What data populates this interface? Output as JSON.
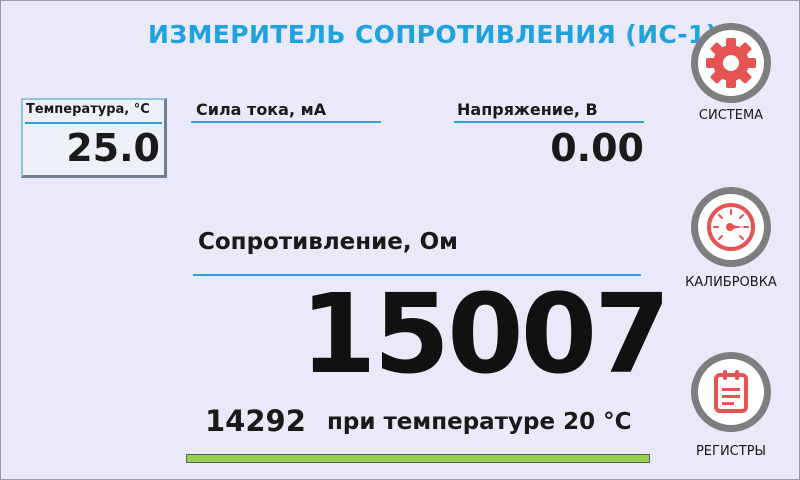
{
  "header": {
    "title": "ИЗМЕРИТЕЛЬ СОПРОТИВЛЕНИЯ (ИС-1)"
  },
  "temperature": {
    "label": "Температура, °С",
    "value": "25.0"
  },
  "current": {
    "label": "Сила тока, мА",
    "value": ""
  },
  "voltage": {
    "label": "Напряжение, В",
    "value": "0.00"
  },
  "resistance": {
    "label": "Сопротивление, Ом",
    "value": "15007",
    "reference_value": "14292",
    "reference_text": "при температуре 20 °С",
    "progress": 1.0
  },
  "sidebar": {
    "system": {
      "label": "СИСТЕМА",
      "icon": "gear-icon"
    },
    "calibration": {
      "label": "КАЛИБРОВКА",
      "icon": "gauge-icon"
    },
    "registers": {
      "label": "РЕГИСТРЫ",
      "icon": "clipboard-icon"
    }
  },
  "colors": {
    "accent": "#1ea3dd",
    "icon_red": "#e55353",
    "progress_green": "#95d14a",
    "background": "#e9e9f9"
  }
}
